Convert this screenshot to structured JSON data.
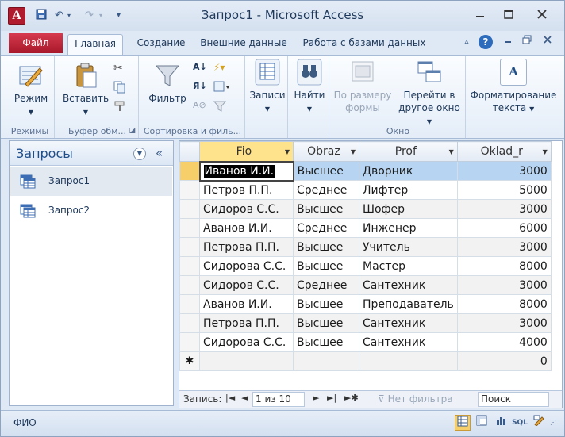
{
  "window": {
    "title": "Запрос1 - Microsoft Access",
    "app_icon_letter": "A"
  },
  "tabs": {
    "file": "Файл",
    "home": "Главная",
    "create": "Создание",
    "external": "Внешние данные",
    "database": "Работа с базами данных"
  },
  "ribbon": {
    "views": {
      "mode": "Режим",
      "group": "Режимы"
    },
    "clipboard": {
      "paste": "Вставить",
      "group": "Буфер обм..."
    },
    "sort": {
      "filter": "Фильтр",
      "group": "Сортировка и филь..."
    },
    "records": {
      "label": "Записи"
    },
    "find": {
      "label": "Найти"
    },
    "window": {
      "fit": "По размеру формы",
      "fit_line1": "По размеру",
      "fit_line2": "формы",
      "switch_line1": "Перейти в",
      "switch_line2": "другое окно",
      "group": "Окно"
    },
    "format": {
      "line1": "Форматирование",
      "line2": "текста",
      "icon_letter": "A"
    }
  },
  "nav": {
    "title": "Запросы",
    "items": [
      {
        "label": "Запрос1"
      },
      {
        "label": "Запрос2"
      }
    ]
  },
  "datasheet": {
    "columns": [
      "Fio",
      "Obraz",
      "Prof",
      "Oklad_r"
    ],
    "rows": [
      [
        "Иванов И.И.",
        "Высшее",
        "Дворник",
        "3000"
      ],
      [
        "Петров П.П.",
        "Среднее",
        "Лифтер",
        "5000"
      ],
      [
        "Сидоров С.С.",
        "Высшее",
        "Шофер",
        "3000"
      ],
      [
        "Аванов И.И.",
        "Среднее",
        "Инженер",
        "6000"
      ],
      [
        "Петрова П.П.",
        "Высшее",
        "Учитель",
        "3000"
      ],
      [
        "Сидорова С.С.",
        "Высшее",
        "Мастер",
        "8000"
      ],
      [
        "Сидоров С.С.",
        "Среднее",
        "Сантехник",
        "3000"
      ],
      [
        "Аванов И.И.",
        "Высшее",
        "Преподаватель",
        "8000"
      ],
      [
        "Петрова П.П.",
        "Высшее",
        "Сантехник",
        "3000"
      ],
      [
        "Сидорова С.С.",
        "Высшее",
        "Сантехник",
        "4000"
      ]
    ],
    "new_row_marker": "✱",
    "new_row_default": "0"
  },
  "recnav": {
    "label": "Запись:",
    "position": "1 из 10",
    "filter": "Нет фильтра",
    "search": "Поиск"
  },
  "status": {
    "text": "ФИО",
    "sql": "SQL"
  }
}
